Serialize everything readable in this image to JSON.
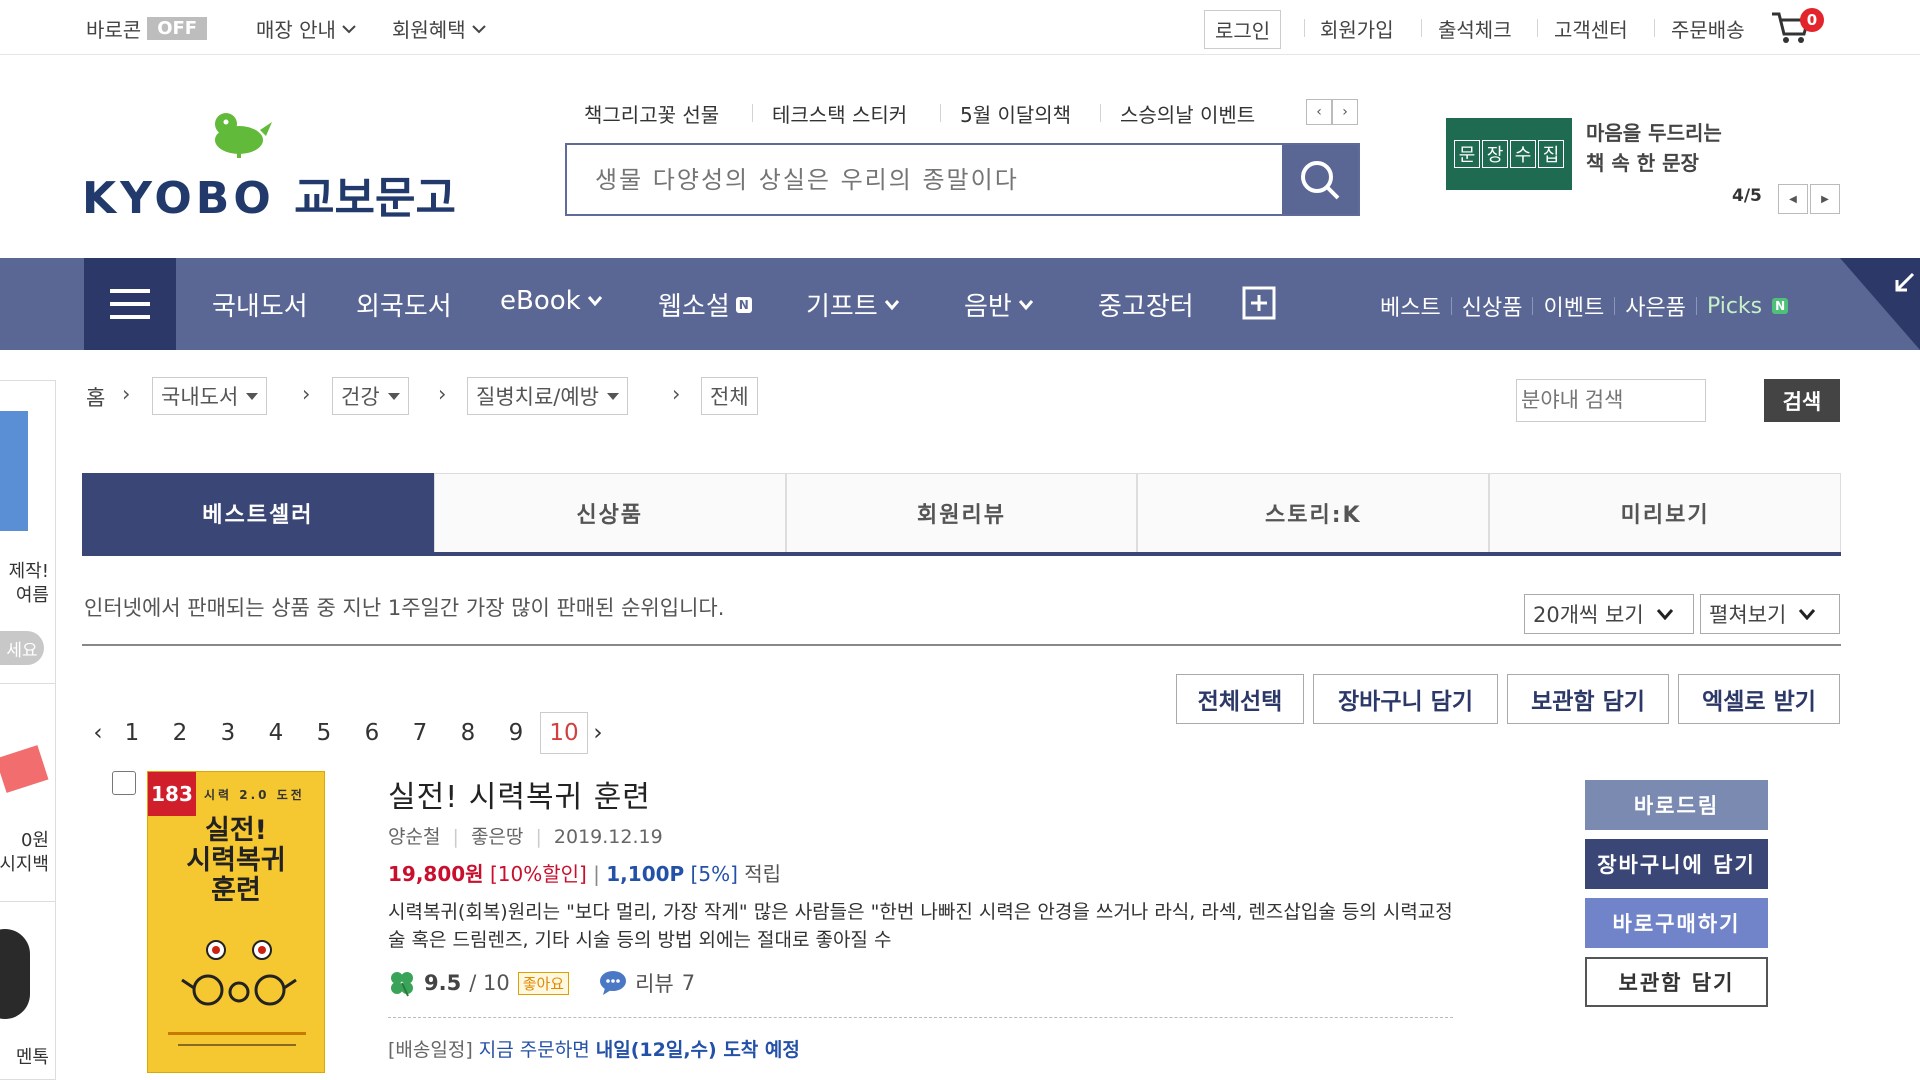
{
  "topbar": {
    "barocon": "바로콘",
    "barocon_state": "OFF",
    "store_guide": "매장 안내",
    "member_benefit": "회원혜택",
    "login": "로그인",
    "join": "회원가입",
    "attendance": "출석체크",
    "customer_center": "고객센터",
    "order_delivery": "주문배송",
    "cart_count": "0"
  },
  "header": {
    "logo_en": "KYOBO",
    "logo_kr": "교보문고",
    "links": [
      "책그리고꽃 선물",
      "테크스택 스티커",
      "5월 이달의책",
      "스승의날 이벤트"
    ],
    "search_placeholder": "생물 다양성의 상실은 우리의 종말이다",
    "promo_chars": [
      "문",
      "장",
      "수",
      "집"
    ],
    "promo_line1": "마음을 두드리는",
    "promo_line2": "책 속 한 문장",
    "promo_page": "4/5"
  },
  "nav": {
    "items": [
      "국내도서",
      "외국도서",
      "eBook",
      "웹소설",
      "기프트",
      "음반",
      "중고장터"
    ],
    "webnovel_badge": "N",
    "right": [
      "베스트",
      "신상품",
      "이벤트",
      "사은품",
      "Picks"
    ],
    "picks_badge": "N"
  },
  "breadcrumb": {
    "home": "홈",
    "level1": "국내도서",
    "level2": "건강",
    "level3": "질병치료/예방",
    "level4": "전체",
    "search_placeholder": "분야내 검색",
    "search_button": "검색"
  },
  "tabs": [
    "베스트셀러",
    "신상품",
    "회원리뷰",
    "스토리:K",
    "미리보기"
  ],
  "listing": {
    "description": "인터넷에서 판매되는 상품 중 지난 1주일간 가장 많이 판매된 순위입니다.",
    "per_page": "20개씩 보기",
    "view_mode": "펼쳐보기",
    "actions": [
      "전체선택",
      "장바구니 담기",
      "보관함 담기",
      "엑셀로 받기"
    ],
    "pages": [
      "1",
      "2",
      "3",
      "4",
      "5",
      "6",
      "7",
      "8",
      "9",
      "10"
    ],
    "current_page": "10"
  },
  "book": {
    "rank": "183",
    "cover_series": "시력 2.0 도전",
    "cover_title1": "실전!",
    "cover_title2": "시력복귀",
    "cover_title3": "훈련",
    "title": "실전! 시력복귀 훈련",
    "author": "양순철",
    "publisher": "좋은땅",
    "date": "2019.12.19",
    "price": "19,800원",
    "discount": "[10%할인]",
    "points": "1,100P",
    "points_rate": "[5%]",
    "points_label": "적립",
    "summary": "시력복귀(회복)원리는 \"보다 멀리, 가장 작게\" 많은 사람들은 \"한번 나빠진 시력은 안경을 쓰거나 라식, 라섹, 렌즈삽입술 등의 시력교정술 혹은 드림렌즈, 기타 시술 등의 방법 외에는 절대로 좋아질 수",
    "rating": "9.5",
    "rating_max": "/ 10",
    "like_badge": "좋아요",
    "review_label": "리뷰",
    "review_count": "7",
    "ship_prefix": "[배송일정]",
    "ship_now": "지금 주문하면",
    "ship_date": "내일(12일,수) 도착 예정",
    "buttons": [
      "바로드림",
      "장바구니에 담기",
      "바로구매하기",
      "보관함 담기"
    ]
  },
  "left_sidebar": {
    "text1": "제작!",
    "text2": "여름",
    "btn": "세요",
    "text3": "0원",
    "text4": "시지백",
    "text5": "멘톡"
  },
  "colors": {
    "nav": "#5a6694",
    "nav_dark": "#2c3868",
    "price_red": "#c8102e",
    "point_blue": "#2451a8",
    "promo_green": "#1e6b52"
  }
}
